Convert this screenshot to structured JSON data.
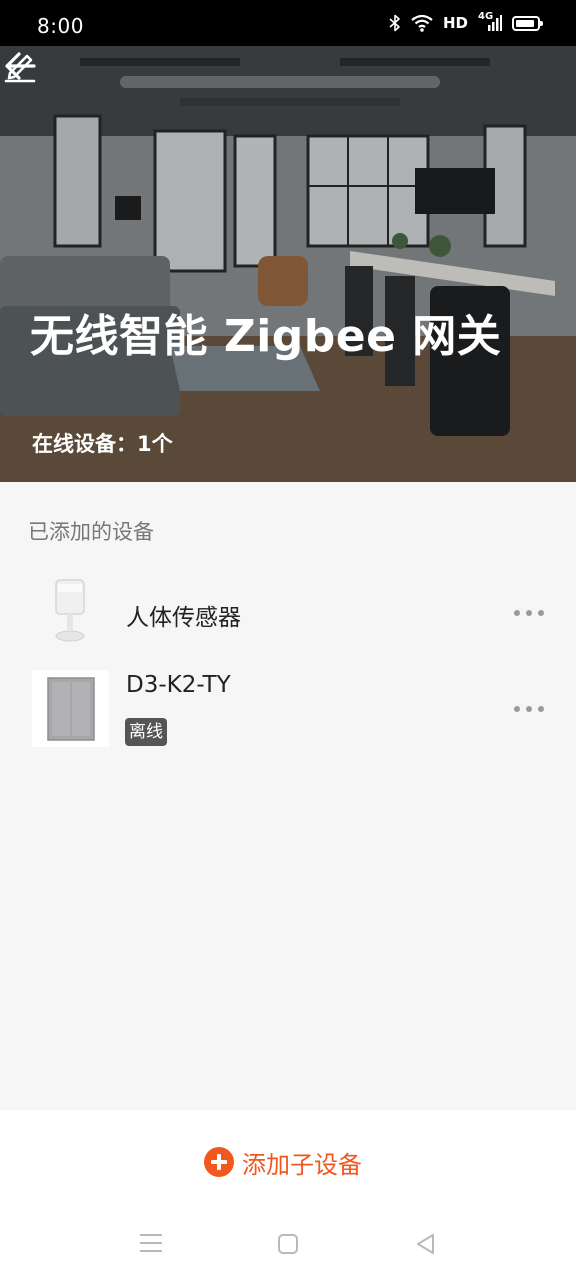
{
  "status_bar": {
    "time": "8:00",
    "hd_label": "HD",
    "signal_label": "4G",
    "battery_level": 0.9
  },
  "header": {
    "title": "无线智能 Zigbee 网关",
    "online_label": "在线设备：1个",
    "back_icon": "arrow-left-icon",
    "edit_icon": "pencil-icon"
  },
  "devices": {
    "section_label": "已添加的设备",
    "items": [
      {
        "name": "人体传感器",
        "icon": "motion-sensor-icon",
        "status": ""
      },
      {
        "name": "D3-K2-TY",
        "icon": "wall-switch-icon",
        "status": "离线"
      }
    ]
  },
  "bottom": {
    "add_label": "添加子设备",
    "accent_color": "#f2581e"
  },
  "navbar": {
    "menu_icon": "menu-icon",
    "home_icon": "home-square-icon",
    "back_icon": "back-triangle-icon"
  }
}
